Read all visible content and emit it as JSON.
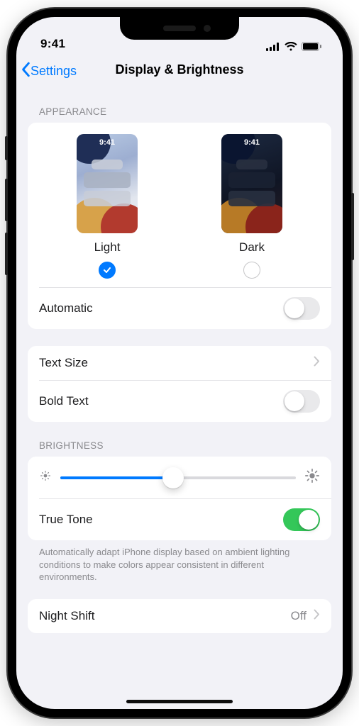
{
  "status": {
    "time": "9:41"
  },
  "nav": {
    "back": "Settings",
    "title": "Display & Brightness"
  },
  "appearance": {
    "header": "APPEARANCE",
    "modes": [
      {
        "label": "Light",
        "preview_time": "9:41",
        "checked": true
      },
      {
        "label": "Dark",
        "preview_time": "9:41",
        "checked": false
      }
    ],
    "automatic": {
      "label": "Automatic",
      "on": false
    }
  },
  "text": {
    "text_size": "Text Size",
    "bold_text": {
      "label": "Bold Text",
      "on": false
    }
  },
  "brightness": {
    "header": "BRIGHTNESS",
    "slider_percent": 48,
    "true_tone": {
      "label": "True Tone",
      "on": true
    },
    "footer": "Automatically adapt iPhone display based on ambient lighting conditions to make colors appear consistent in different environments."
  },
  "night_shift": {
    "label": "Night Shift",
    "value": "Off"
  }
}
